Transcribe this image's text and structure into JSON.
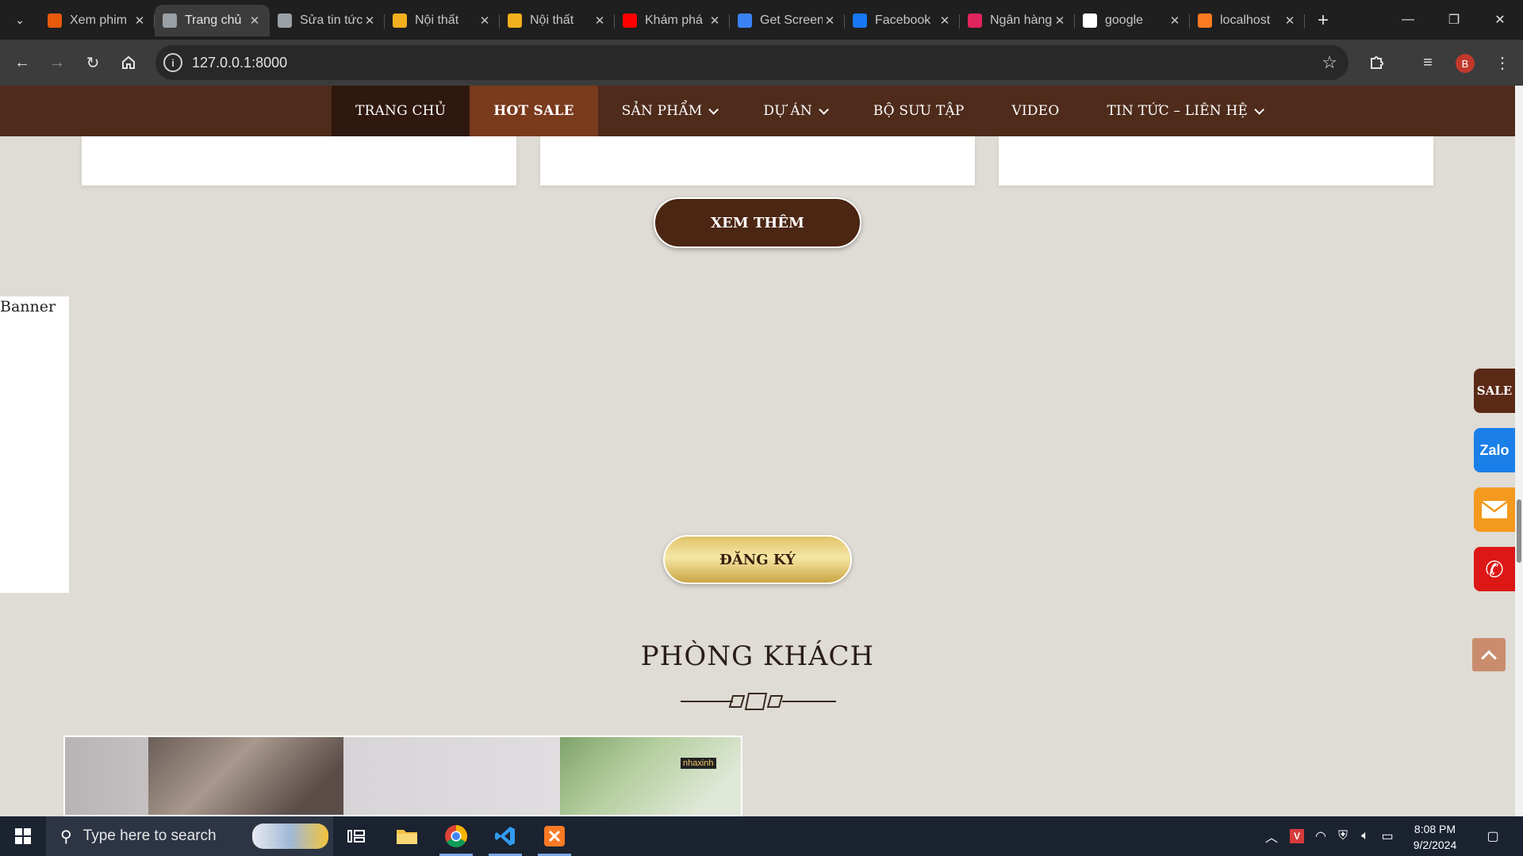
{
  "browser": {
    "tabs": [
      {
        "title": "Xem phim",
        "favicon": "play-icon",
        "color": "#e8590c",
        "active": false
      },
      {
        "title": "Trang chủ",
        "favicon": "globe-icon",
        "color": "#9aa0a6",
        "active": true
      },
      {
        "title": "Sửa tin tức",
        "favicon": "globe-icon",
        "color": "#9aa0a6",
        "active": false
      },
      {
        "title": "Nội thất",
        "favicon": "home-icon",
        "color": "#f2b01e",
        "active": false
      },
      {
        "title": "Nội thất",
        "favicon": "home-icon",
        "color": "#f2b01e",
        "active": false
      },
      {
        "title": "Khám phá",
        "favicon": "youtube-icon",
        "color": "#ff0000",
        "active": false
      },
      {
        "title": "Get Screenshot",
        "favicon": "h-icon",
        "color": "#3b82f6",
        "active": false
      },
      {
        "title": "Facebook",
        "favicon": "facebook-icon",
        "color": "#1877f2",
        "active": false
      },
      {
        "title": "Ngân hàng",
        "favicon": "e-icon",
        "color": "#e0245e",
        "active": false
      },
      {
        "title": "google",
        "favicon": "google-icon",
        "color": "#ffffff",
        "active": false
      },
      {
        "title": "localhost",
        "favicon": "xampp-icon",
        "color": "#fb7a24",
        "active": false
      }
    ],
    "url": "127.0.0.1:8000",
    "profile_initial": "B"
  },
  "site_nav": {
    "items": [
      {
        "label": "TRANG CHỦ",
        "dropdown": false
      },
      {
        "label": "HOT SALE",
        "dropdown": false
      },
      {
        "label": "SẢN PHẨM",
        "dropdown": true
      },
      {
        "label": "DỰ ÁN",
        "dropdown": true
      },
      {
        "label": "BỘ SƯU TẬP",
        "dropdown": false
      },
      {
        "label": "VIDEO",
        "dropdown": false
      },
      {
        "label": "TIN TỨC – LIÊN HỆ",
        "dropdown": true
      }
    ]
  },
  "main": {
    "more_button": "XEM THÊM",
    "banner_alt": "Banner",
    "register_button": "ĐĂNG KÝ",
    "section_title": "PHÒNG KHÁCH",
    "image_watermark": "nhaxinh"
  },
  "floating": {
    "sale": "SALE",
    "zalo": "Zalo"
  },
  "taskbar": {
    "search_placeholder": "Type here to search",
    "time": "8:08 PM",
    "date": "9/2/2024"
  }
}
